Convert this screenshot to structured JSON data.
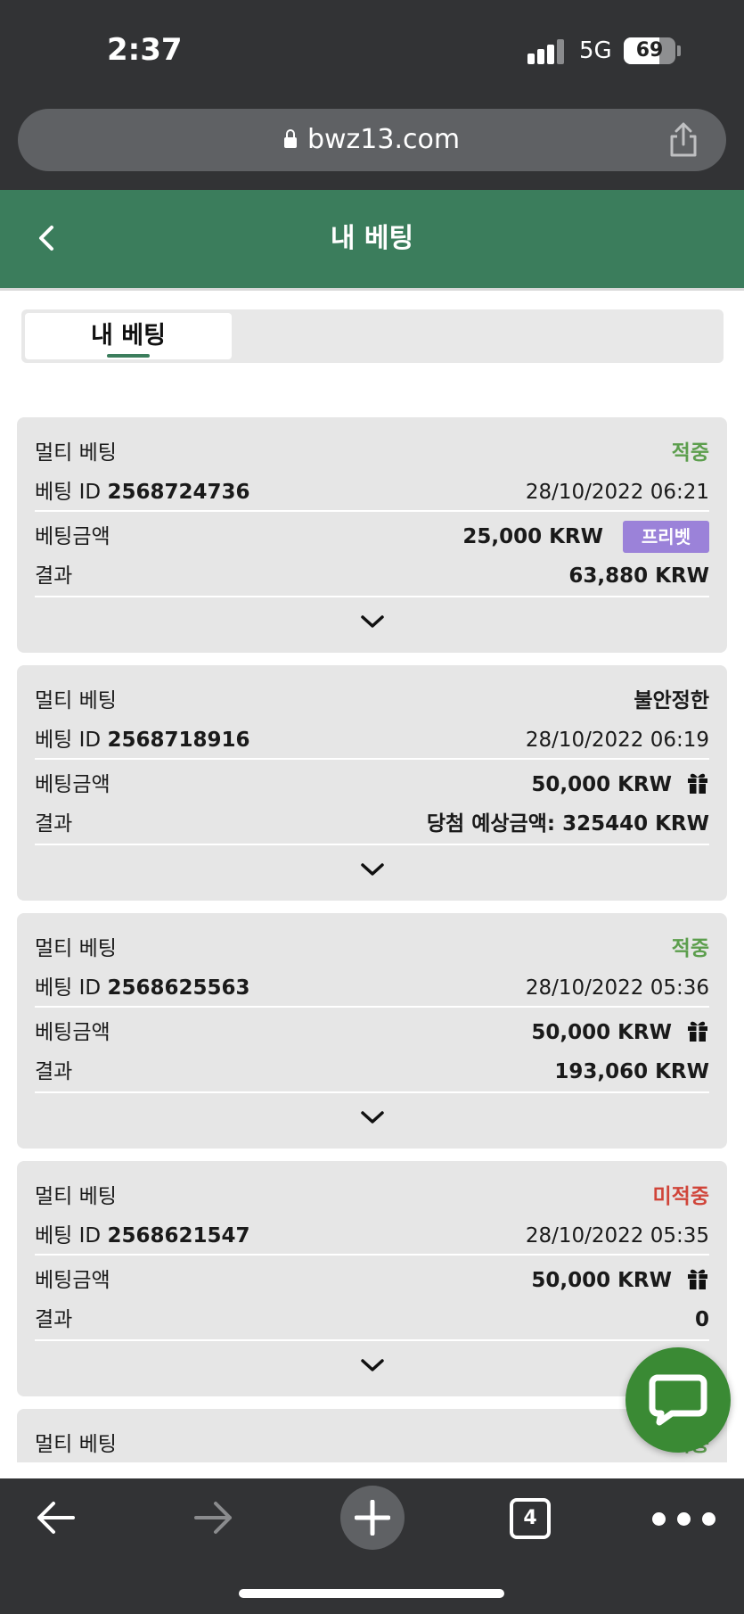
{
  "status_bar": {
    "time": "2:37",
    "network": "5G",
    "battery_percent": 69,
    "battery_label": "69"
  },
  "browser": {
    "url": "bwz13.com",
    "tabs_count": "4"
  },
  "header": {
    "title": "내 베팅"
  },
  "tabs": [
    {
      "label": "내 베팅",
      "active": true
    }
  ],
  "bets": [
    {
      "type": "멀티 베팅",
      "status": "적중",
      "status_kind": "win",
      "id_label": "베팅 ID",
      "id": "2568724736",
      "datetime": "28/10/2022 06:21",
      "amount_label": "베팅금액",
      "amount": "25,000 KRW",
      "badge": "프리벳",
      "result_label": "결과",
      "result": "63,880 KRW"
    },
    {
      "type": "멀티 베팅",
      "status": "불안정한",
      "status_kind": "pending",
      "id_label": "베팅 ID",
      "id": "2568718916",
      "datetime": "28/10/2022 06:19",
      "amount_label": "베팅금액",
      "amount": "50,000 KRW",
      "icon": "gift-icon",
      "result_label": "결과",
      "result": "당첨 예상금액: 325440 KRW"
    },
    {
      "type": "멀티 베팅",
      "status": "적중",
      "status_kind": "win",
      "id_label": "베팅 ID",
      "id": "2568625563",
      "datetime": "28/10/2022 05:36",
      "amount_label": "베팅금액",
      "amount": "50,000 KRW",
      "icon": "gift-icon",
      "result_label": "결과",
      "result": "193,060 KRW"
    },
    {
      "type": "멀티 베팅",
      "status": "미적중",
      "status_kind": "lose",
      "id_label": "베팅 ID",
      "id": "2568621547",
      "datetime": "28/10/2022 05:35",
      "amount_label": "베팅금액",
      "amount": "50,000 KRW",
      "icon": "gift-icon",
      "result_label": "결과",
      "result": "0"
    },
    {
      "type": "멀티 베팅",
      "status": "적중",
      "status_kind": "win"
    }
  ],
  "colors": {
    "header_green": "#3b7d5c",
    "win": "#5c9e4d",
    "lose": "#d0453a",
    "freebet_badge": "#9b82d9",
    "chat_fab": "#3a8a34"
  }
}
